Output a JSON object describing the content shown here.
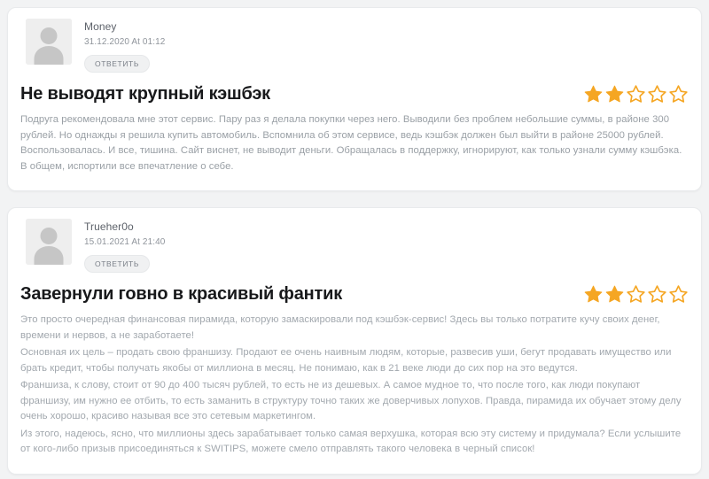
{
  "theme": {
    "page_background": "#f2f3f4",
    "card_background": "#ffffff",
    "star_filled_color": "#f5a623",
    "star_empty_color": "#f5a623",
    "title_color": "#18191b",
    "body_color": "#9aa0a6"
  },
  "reviews": [
    {
      "author": "Money",
      "date": "31.12.2020 At 01:12",
      "reply_label": "ОТВЕТИТЬ",
      "avatar_icon": "user-avatar-placeholder-icon",
      "rating": 2,
      "rating_max": 5,
      "title": "Не выводят крупный кэшбэк",
      "paragraphs": [
        "Подруга рекомендовала мне этот сервис. Пару раз я делала покупки через него. Выводили без проблем небольшие суммы, в районе 300 рублей. Но однажды я решила купить автомобиль. Вспомнила об этом сервисе, ведь кэшбэк должен был выйти в районе 25000 рублей. Воспользовалась. И все, тишина. Сайт виснет, не выводит деньги. Обращалась в поддержку, игнорируют, как только узнали сумму кэшбэка. В общем, испортили все впечатление о себе."
      ]
    },
    {
      "author": "Trueher0o",
      "date": "15.01.2021 At 21:40",
      "reply_label": "ОТВЕТИТЬ",
      "avatar_icon": "user-avatar-placeholder-icon",
      "rating": 2,
      "rating_max": 5,
      "title": "Завернули говно в красивый фантик",
      "paragraphs": [
        "Это просто очередная финансовая пирамида, которую замаскировали под кэшбэк-сервис! Здесь вы только потратите кучу своих денег, времени и нервов, а не заработаете!",
        "Основная их цель – продать свою франшизу. Продают ее очень наивным людям, которые, развесив уши, бегут продавать имущество или брать кредит, чтобы получать якобы от миллиона в месяц. Не понимаю, как в 21 веке люди до сих пор на это ведутся.",
        "Франшиза, к слову, стоит от 90 до 400 тысяч рублей, то есть не из дешевых. А самое мудное то, что после того, как люди покупают франшизу, им нужно ее отбить, то есть заманить в структуру точно таких же доверчивых лопухов. Правда, пирамида их обучает этому делу очень хорошо, красиво называя все это сетевым маркетингом.",
        "Из этого, надеюсь, ясно, что миллионы здесь зарабатывает только самая верхушка, которая всю эту систему и придумала? Если услышите от кого-либо призыв присоединяться к SWITIPS, можете смело отправлять такого человека в черный список!"
      ]
    }
  ]
}
